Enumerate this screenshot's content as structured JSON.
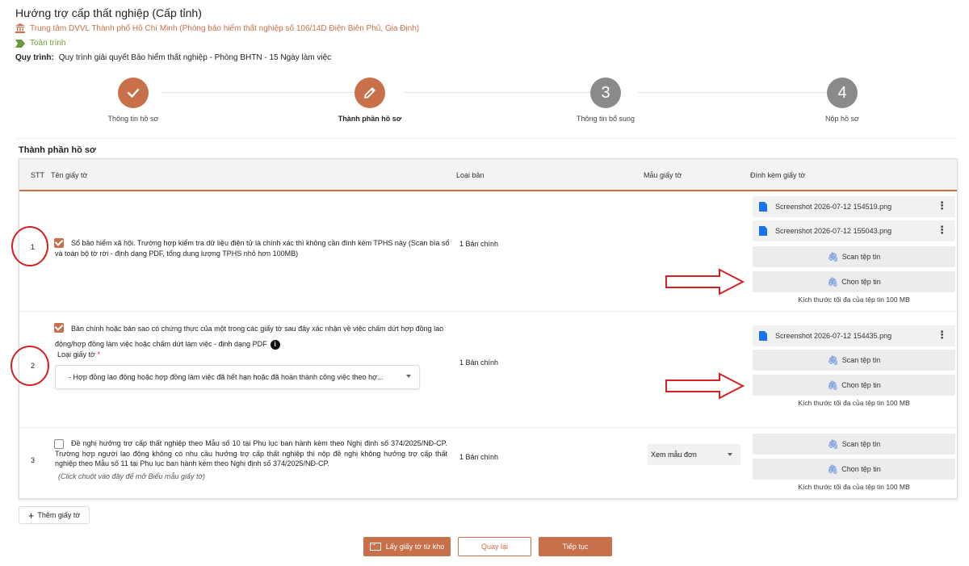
{
  "header": {
    "title": "Hướng trợ cấp thất nghiệp (Cấp tỉnh)",
    "org": "Trung tâm DVVL Thành phố Hồ Chí Minh (Phòng bảo hiểm thất nghiệp số 106/14D Điện Biên Phủ, Gia Định)",
    "scope": "Toàn trình",
    "process_label": "Quy trình:",
    "process_value": "Quy trình giải quyết Bảo hiểm thất nghiệp - Phòng BHTN - 15 Ngày làm việc"
  },
  "steps": [
    {
      "label": "Thông tin hồ sơ",
      "state": "done",
      "icon": "check-icon"
    },
    {
      "label": "Thành phần hồ sơ",
      "state": "active",
      "icon": "pencil-icon"
    },
    {
      "label": "Thông tin bổ sung",
      "state": "todo",
      "number": "3"
    },
    {
      "label": "Nộp hồ sơ",
      "state": "todo",
      "number": "4"
    }
  ],
  "section_title": "Thành phần hồ sơ",
  "table": {
    "headers": {
      "stt": "STT",
      "ten": "Tên giấy tờ",
      "loai": "Loại bản",
      "mau": "Mẫu giấy tờ",
      "dinhkem": "Đính kèm giấy tờ"
    },
    "rows": [
      {
        "stt": "1",
        "checked": true,
        "name": "Sổ bảo hiểm xã hội. Trường hợp kiểm tra dữ liệu điện tử là chính xác thì không cần đính kèm TPHS này (Scan bìa sổ và toàn bộ tờ rời - định dạng PDF, tổng dung lượng TPHS nhỏ hơn 100MB)",
        "loai": "1 Bản chính",
        "files": [
          "Screenshot 2026-07-12 154519.png",
          "Screenshot 2026-07-12 155043.png"
        ],
        "scan_label": "Scan tệp tin",
        "choose_label": "Chọn tệp tin",
        "max_size": "Kích thước tối đa của tệp tin 100 MB"
      },
      {
        "stt": "2",
        "checked": true,
        "name": "Bản chính hoặc bản sao có chứng thực của một trong các giấy tờ sau đây xác nhận về việc chấm dứt hợp đồng lao động/hợp đồng làm việc hoặc chấm dứt làm việc - định dạng PDF",
        "sub_label": "Loại giấy tờ",
        "select_value": "- Hợp đồng lao động hoặc hợp đồng làm việc đã hết hạn hoặc đã hoàn thành công việc theo hợ...",
        "loai": "1 Bản chính",
        "files": [
          "Screenshot 2026-07-12 154435.png"
        ],
        "scan_label": "Scan tệp tin",
        "choose_label": "Chọn tệp tin",
        "max_size": "Kích thước tối đa của tệp tin 100 MB"
      },
      {
        "stt": "3",
        "checked": false,
        "name": "Đề nghị hưởng trợ cấp thất nghiệp theo Mẫu số 10 tại Phụ lục ban hành kèm theo Nghị định số 374/2025/NĐ-CP. Trường hợp người lao động không có nhu cầu hưởng trợ cấp thất nghiệp thì nộp đề nghị không hưởng trợ cấp thất nghiệp theo Mẫu số 11 tại Phụ lục ban hành kèm theo Nghị định số 374/2025/NĐ-CP.",
        "hint": "(Click chuột vào đây để mở Biểu mẫu giấy tờ)",
        "loai": "1 Bản chính",
        "mau_value": "Xem mẫu đơn",
        "scan_label": "Scan tệp tin",
        "choose_label": "Chọn tệp tin",
        "max_size": "Kích thước tối đa của tệp tin 100 MB"
      }
    ]
  },
  "add_button": "Thêm giấy tờ",
  "footer": {
    "fetch": "Lấy giấy tờ từ kho",
    "back": "Quay lại",
    "next": "Tiếp tục"
  },
  "colors": {
    "accent": "#c8704a",
    "annotation": "#d32222"
  }
}
